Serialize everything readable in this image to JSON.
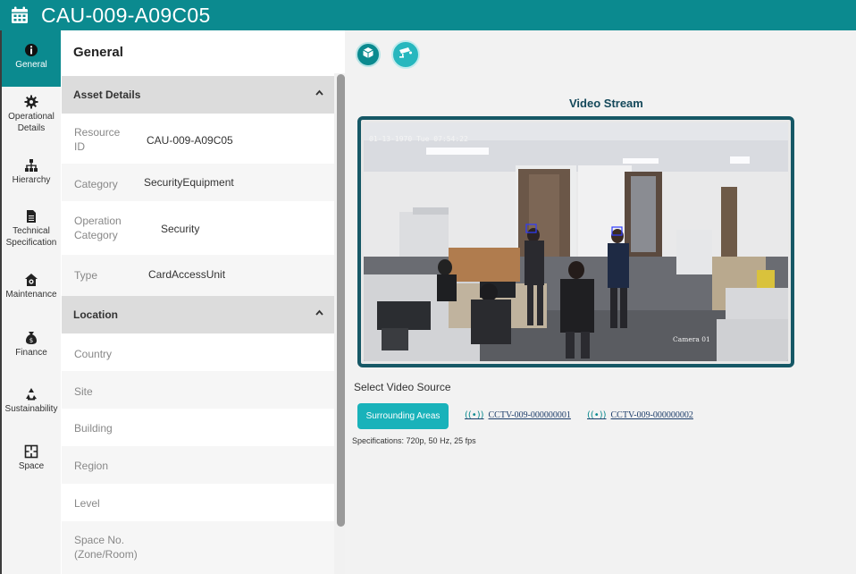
{
  "header": {
    "title": "CAU-009-A09C05",
    "icon": "calendar-icon"
  },
  "rail": {
    "items": [
      {
        "label": "General",
        "icon": "info-icon",
        "active": true
      },
      {
        "label": "Operational Details",
        "icon": "gear-icon"
      },
      {
        "label": "Hierarchy",
        "icon": "hierarchy-icon"
      },
      {
        "label": "Technical Specification",
        "icon": "document-icon"
      },
      {
        "label": "Maintenance",
        "icon": "house-gear-icon"
      },
      {
        "label": "Finance",
        "icon": "money-bag-icon"
      },
      {
        "label": "Sustainability",
        "icon": "recycle-icon"
      },
      {
        "label": "Space",
        "icon": "floorplan-icon"
      }
    ]
  },
  "panel": {
    "title": "General",
    "asset_details": {
      "title": "Asset Details",
      "rows": [
        {
          "label": "Resource ID",
          "value": "CAU-009-A09C05"
        },
        {
          "label": "Category",
          "value": "SecurityEquipment"
        },
        {
          "label": "Operation Category",
          "value": "Security"
        },
        {
          "label": "Type",
          "value": "CardAccessUnit"
        }
      ]
    },
    "location": {
      "title": "Location",
      "rows": [
        {
          "label": "Country",
          "value": ""
        },
        {
          "label": "Site",
          "value": ""
        },
        {
          "label": "Building",
          "value": ""
        },
        {
          "label": "Region",
          "value": ""
        },
        {
          "label": "Level",
          "value": ""
        },
        {
          "label": "Space No. (Zone/Room)",
          "value": ""
        }
      ]
    }
  },
  "main": {
    "tools": [
      {
        "icon": "cube-icon"
      },
      {
        "icon": "cctv-camera-icon"
      }
    ],
    "video_title": "Video Stream",
    "video_timestamp": "01-13-1970 Tue 07:54:22",
    "video_camera_label": "Camera 01",
    "select_label": "Select Video Source",
    "sources": {
      "active": "Surrounding Areas",
      "links": [
        "CCTV-009-000000001",
        "CCTV-009-000000002"
      ]
    },
    "specs": "Specifications: 720p, 50 Hz, 25 fps"
  },
  "colors": {
    "brand": "#0b8a8f",
    "button": "#19b2ba",
    "frame": "#165866"
  }
}
